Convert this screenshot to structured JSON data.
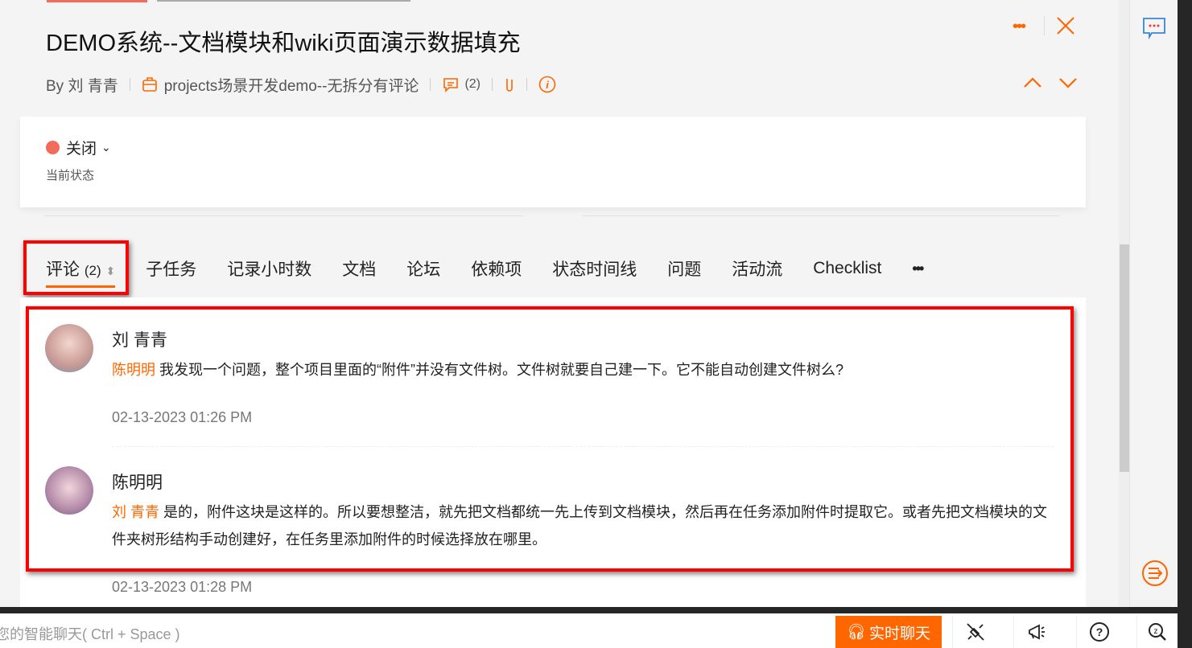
{
  "header": {
    "title": "DEMO系统--文档模块和wiki页面演示数据填充",
    "author": "By 刘 青青",
    "project": "projects场景开发demo--无拆分有评论",
    "comment_count": "(2)"
  },
  "status": {
    "value": "关闭",
    "label": "当前状态",
    "color": "#f26b5b"
  },
  "tabs": [
    {
      "label": "评论",
      "count": "(2)"
    },
    {
      "label": "子任务"
    },
    {
      "label": "记录小时数"
    },
    {
      "label": "文档"
    },
    {
      "label": "论坛"
    },
    {
      "label": "依赖项"
    },
    {
      "label": "状态时间线"
    },
    {
      "label": "问题"
    },
    {
      "label": "活动流"
    },
    {
      "label": "Checklist"
    },
    {
      "label": "•••"
    }
  ],
  "comments": [
    {
      "author": "刘 青青",
      "mention": "陈明明",
      "text": " 我发现一个问题，整个项目里面的“附件”并没有文件树。文件树就要自己建一下。它不能自动创建文件树么?",
      "time": "02-13-2023 01:26 PM"
    },
    {
      "author": "陈明明",
      "mention": "刘 青青",
      "text": " 是的，附件这块是这样的。所以要想整洁，就先把文档都统一先上传到文档模块，然后再在任务添加附件时提取它。或者先把文档模块的文件夹树形结构手动创建好，在任务里添加附件的时候选择放在哪里。",
      "time": "02-13-2023 01:28 PM"
    }
  ],
  "bottom": {
    "chat_hint": "您的智能聊天( Ctrl + Space )",
    "live_chat": "实时聊天"
  },
  "accent": "#ff6600"
}
